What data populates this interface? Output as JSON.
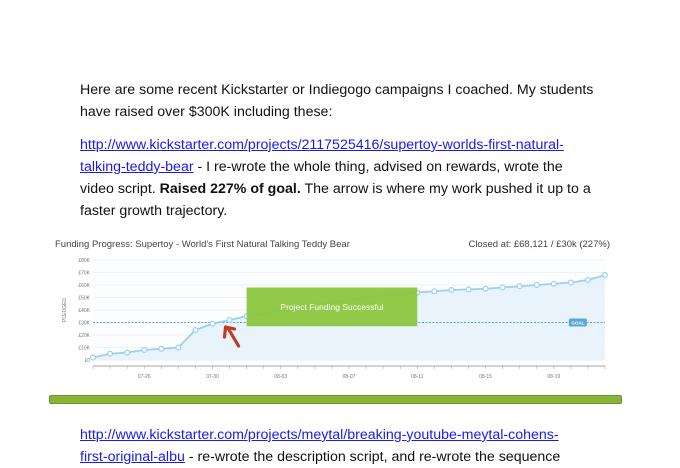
{
  "intro": {
    "line1": "Here are some recent Kickstarter or Indiegogo campaigns I coached. My students",
    "line2": "have raised over $300K including these:"
  },
  "campaign1": {
    "link_line1": "http://www.kickstarter.com/projects/2117525416/supertoy-worlds-first-natural-",
    "link_line2": "talking-teddy-bear",
    "desc_after_link": " - I re-wrote the whole thing, advised on rewards, wrote the",
    "line3_plain": "video script. ",
    "line3_bold": "Raised 227% of goal.",
    "line3_rest": " The arrow is where my work pushed it up to a",
    "line4": "faster growth trajectory."
  },
  "campaign2": {
    "link_line1": "http://www.kickstarter.com/projects/meytal/breaking-youtube-meytal-cohens-",
    "link_line2": "first-original-albu",
    "desc_after_link": " - re-wrote the description script, and re-wrote the sequence"
  },
  "chart_data": {
    "type": "line",
    "title": "Funding Progress: Supertoy - World's First Natural Talking Teddy Bear",
    "closed_label": "Closed at: £68,121 / £30k (227%)",
    "ylabel": "PLEDGED",
    "ylim": [
      0,
      80000
    ],
    "yticks": [
      "£0",
      "£10K",
      "£20K",
      "£30K",
      "£40K",
      "£50K",
      "£60K",
      "£70K",
      "£80K"
    ],
    "xticks": [
      "07-26",
      "07-30",
      "08-03",
      "08-07",
      "08-11",
      "08-15",
      "08-19"
    ],
    "x": [
      "07-23",
      "07-24",
      "07-25",
      "07-26",
      "07-27",
      "07-28",
      "07-29",
      "07-30",
      "07-31",
      "08-01",
      "08-02",
      "08-03",
      "08-04",
      "08-05",
      "08-06",
      "08-07",
      "08-08",
      "08-09",
      "08-10",
      "08-11",
      "08-12",
      "08-13",
      "08-14",
      "08-15",
      "08-16",
      "08-17",
      "08-18",
      "08-19",
      "08-20",
      "08-21",
      "08-22"
    ],
    "values": [
      2000,
      5000,
      6000,
      8000,
      9000,
      10000,
      24000,
      29000,
      32000,
      35000,
      37000,
      40000,
      42000,
      44000,
      46000,
      48000,
      50000,
      52000,
      53000,
      54000,
      55000,
      56000,
      56500,
      57000,
      58000,
      59000,
      60000,
      61000,
      62000,
      64000,
      68000
    ],
    "goal": 30000,
    "goal_label": "GOAL",
    "banner": "Project Funding Successful",
    "colors": {
      "line": "#9dd0ee",
      "fill": "#e4f1fb",
      "goal": "#5aa8d8",
      "banner": "#8cc63f",
      "arrow": "#c23a1f"
    }
  }
}
